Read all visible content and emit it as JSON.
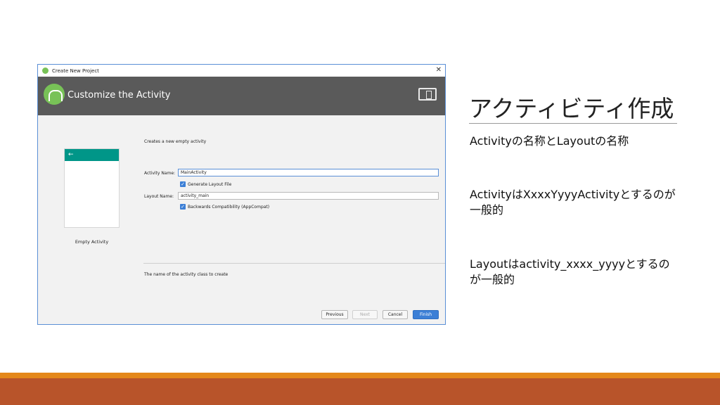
{
  "slide": {
    "title": "アクティビティ作成",
    "bullets": [
      "Activityの名称とLayoutの名称",
      "ActivityはXxxxYyyyActivityとするのが一般的",
      "Layoutはactivity_xxxx_yyyyとするのが一般的"
    ]
  },
  "window": {
    "title": "Create New Project",
    "close_glyph": "✕",
    "header_title": "Customize the Activity",
    "preview": {
      "back_glyph": "←",
      "label": "Empty Activity"
    },
    "form": {
      "description": "Creates a new empty activity",
      "activity_name_label": "Activity Name:",
      "activity_name_value": "MainActivity",
      "generate_layout_label": "Generate Layout File",
      "generate_layout_checked": true,
      "layout_name_label": "Layout Name:",
      "layout_name_value": "activity_main",
      "backwards_compat_label": "Backwards Compatibility (AppCompat)",
      "backwards_compat_checked": true,
      "help_text": "The name of the activity class to create",
      "check_glyph": "✓"
    },
    "buttons": {
      "previous": "Previous",
      "next": "Next",
      "cancel": "Cancel",
      "finish": "Finish"
    }
  },
  "colors": {
    "header": "#5a5a5a",
    "android_green": "#78c257",
    "teal": "#009688",
    "accent_blue": "#3c7fd6",
    "band_orange": "#e4881a",
    "band_rust": "#b8542a"
  },
  "icons": [
    "android-studio-icon",
    "close-icon",
    "device-icon",
    "back-arrow-icon",
    "checkbox-checked-icon"
  ]
}
